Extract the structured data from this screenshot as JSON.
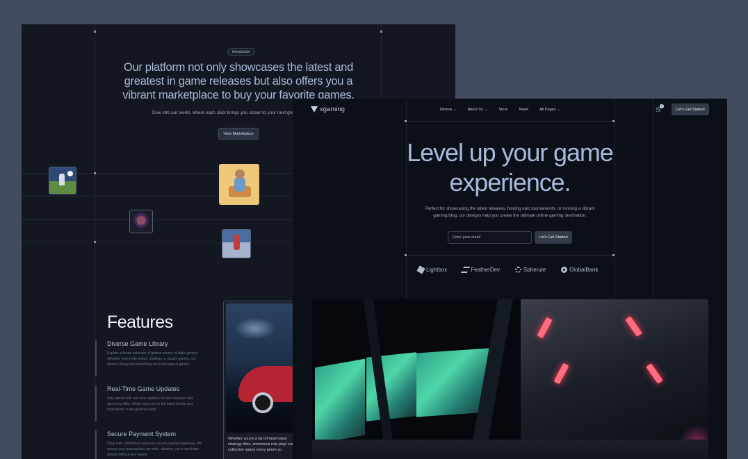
{
  "back": {
    "intro_badge": "Introduction",
    "headline": "Our platform not only showcases the latest and greatest in game releases but also offers you a vibrant marketplace to buy your favorite games.",
    "subtext": "Dive into our world, where each click brings you closer to your next great g",
    "marketplace_button": "View Marketplace",
    "features_title": "Features",
    "features": [
      {
        "title": "Diverse Game Library",
        "desc": "Explore a broad selection of games across multiple genres. Whether you're into action, strategy, or puzzle games, our diverse library has something for every type of gamer."
      },
      {
        "title": "Real-Time Game Updates",
        "desc": "Stay ahead with real-time updates on new releases and upcoming titles. Never miss out on the latest trends and innovations in the gaming world."
      },
      {
        "title": "Secure Payment System",
        "desc": "Shop with confidence using our secure payment gateway. We ensure your transactions are safe, allowing you to purchase games without any hassle."
      }
    ],
    "car_card_text": "Whether you're a fan of heart-poun strategy titles, immersive role-playi our collection spans every genre yo"
  },
  "front": {
    "logo_text": "xgaming",
    "nav": [
      "Demos ⌄",
      "About Us ⌄",
      "Store",
      "News",
      "All Pages ⌄"
    ],
    "cart_icon": "cart-icon",
    "cart_count": "0",
    "header_cta": "Let's Get Started",
    "hero_title": "Level up your game experience.",
    "hero_subtitle": "Perfect for showcasing the latest releases, hosting epic tournaments, or running a vibrant gaming blog, our designs help you create the ultimate online gaming destination.",
    "email_placeholder": "Enter your email",
    "hero_cta": "Let's Get Started",
    "brands": [
      "Lightbox",
      "FeatherDev",
      "Spherule",
      "GlobalBank"
    ]
  },
  "colors": {
    "page_bg": "#434c5e",
    "panel_bg": "#0b0f18",
    "accent": "#a8bbdd"
  }
}
